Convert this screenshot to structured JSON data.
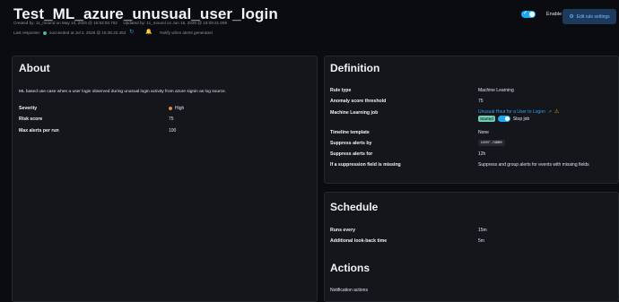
{
  "header": {
    "title": "Test_ML_azure_unusual_user_login",
    "created": "Created by: 11_mound on May 10, 2025 @ 16:53:03.792",
    "updated": "Updated by: 11_mound on Jun 16, 2025 @ 16:09:21.009",
    "last_response_label": "Last response:",
    "last_response_status": "succeeded at Jul 2, 2025 @ 16:35:22.453",
    "notify_text": "Notify when alerts generated",
    "enable_label": "Enable",
    "edit_button": "Edit rule settings",
    "colors": {
      "accent": "#1ba9f5",
      "success": "#54b399"
    }
  },
  "about": {
    "title": "About",
    "description": "ML based use case when a user login observed during unusual login activity from azure signin as log source.",
    "fields": [
      {
        "label": "Severity",
        "value": "High",
        "color": "#da8b45"
      },
      {
        "label": "Risk score",
        "value": "75"
      },
      {
        "label": "Max alerts per run",
        "value": "100"
      }
    ]
  },
  "definition": {
    "title": "Definition",
    "rule_type_label": "Rule type",
    "rule_type_value": "Machine Learning",
    "anomaly_label": "Anomaly score threshold",
    "anomaly_value": "75",
    "ml_job_label": "Machine Learning job",
    "ml_job_link": "Unusual Hour for a User to Logon",
    "ml_job_status": "Started",
    "ml_job_action": "Stop job",
    "timeline_label": "Timeline template",
    "timeline_value": "None",
    "suppress_by_label": "Suppress alerts by",
    "suppress_by_value": "user.name",
    "suppress_for_label": "Suppress alerts for",
    "suppress_for_value": "12h",
    "missing_label": "If a suppression field is missing",
    "missing_value": "Suppress and group alerts for events with missing fields"
  },
  "schedule": {
    "title": "Schedule",
    "runs_label": "Runs every",
    "runs_value": "15m",
    "lookback_label": "Additional look-back time",
    "lookback_value": "5m"
  },
  "actions": {
    "title": "Actions",
    "notification_label": "Notification actions"
  }
}
